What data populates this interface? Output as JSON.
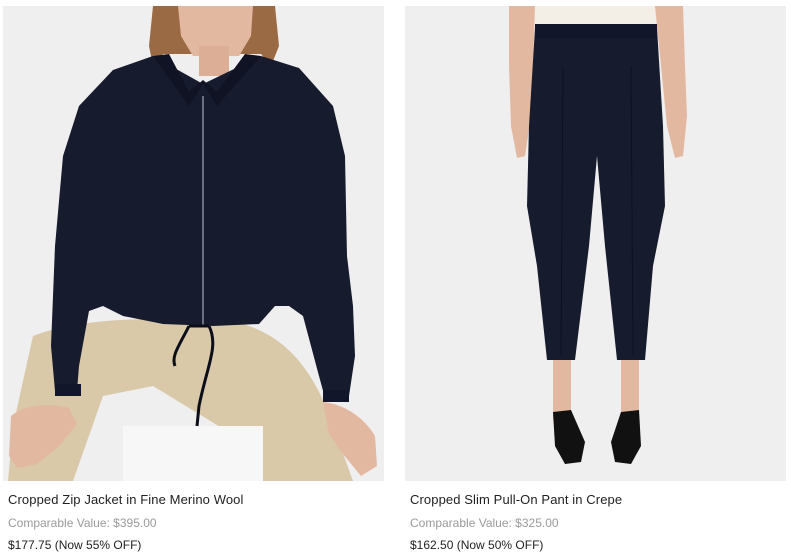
{
  "products": [
    {
      "title": "Cropped Zip Jacket in Fine Merino Wool",
      "comparable_value": "Comparable Value: $395.00",
      "sale_price": "$177.75 (Now 55% OFF)",
      "image_alt": "Cropped Zip Jacket in Fine Merino Wool"
    },
    {
      "title": "Cropped Slim Pull-On Pant in Crepe",
      "comparable_value": "Comparable Value: $325.00",
      "sale_price": "$162.50 (Now 50% OFF)",
      "image_alt": "Cropped Slim Pull-On Pant in Crepe"
    }
  ],
  "colors": {
    "photo_background": "#efefef",
    "garment_navy": "#171b2e",
    "khaki": "#d9c9a8",
    "skin": "#e3b8a0",
    "hair": "#9a6a44",
    "shoe": "#111111"
  }
}
